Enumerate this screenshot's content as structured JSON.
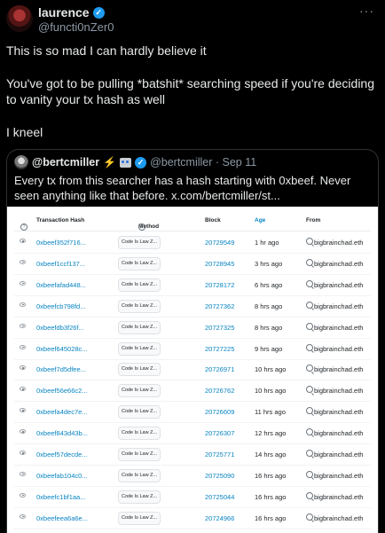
{
  "author": {
    "name": "laurence",
    "handle": "@functi0nZer0"
  },
  "post": {
    "paragraph1": "This is so mad I can hardly believe it",
    "paragraph2": "You've got to be pulling *batshit* searching speed if you're deciding to vanity your tx hash as well",
    "paragraph3": "I kneel"
  },
  "quoted": {
    "name": "@bertcmiller",
    "handle_and_date": "@bertcmiller · Sep 11",
    "text": "Every tx from this searcher has a hash starting with 0xbeef. Never seen anything like that before.  x.com/bertcmiller/st..."
  },
  "colors": {
    "background": "#000000",
    "verified": "#1d9bf0",
    "link": "#0784c3"
  },
  "table": {
    "headers": {
      "hash": "Transaction Hash",
      "method": "Method",
      "block": "Block",
      "age": "Age",
      "from": "From"
    },
    "rows": [
      {
        "hash": "0xbeef352f716...",
        "method": "Code Is Law Z...",
        "block": "20729549",
        "age": "1 hr ago",
        "from": "bigbrainchad.eth"
      },
      {
        "hash": "0xbeef1ccf137...",
        "method": "Code Is Law Z...",
        "block": "20728945",
        "age": "3 hrs ago",
        "from": "bigbrainchad.eth"
      },
      {
        "hash": "0xbeefafad448...",
        "method": "Code Is Law Z...",
        "block": "20728172",
        "age": "6 hrs ago",
        "from": "bigbrainchad.eth"
      },
      {
        "hash": "0xbeefcb798fd...",
        "method": "Code Is Law Z...",
        "block": "20727362",
        "age": "8 hrs ago",
        "from": "bigbrainchad.eth"
      },
      {
        "hash": "0xbeefdb3f26f...",
        "method": "Code Is Law Z...",
        "block": "20727325",
        "age": "8 hrs ago",
        "from": "bigbrainchad.eth"
      },
      {
        "hash": "0xbeef645028c...",
        "method": "Code Is Law Z...",
        "block": "20727225",
        "age": "9 hrs ago",
        "from": "bigbrainchad.eth"
      },
      {
        "hash": "0xbeef7d5dfee...",
        "method": "Code Is Law Z...",
        "block": "20726971",
        "age": "10 hrs ago",
        "from": "bigbrainchad.eth"
      },
      {
        "hash": "0xbeef56e66c2...",
        "method": "Code Is Law Z...",
        "block": "20726762",
        "age": "10 hrs ago",
        "from": "bigbrainchad.eth"
      },
      {
        "hash": "0xbeefa4dec7e...",
        "method": "Code Is Law Z...",
        "block": "20726609",
        "age": "11 hrs ago",
        "from": "bigbrainchad.eth"
      },
      {
        "hash": "0xbeef843d43b...",
        "method": "Code Is Law Z...",
        "block": "20726307",
        "age": "12 hrs ago",
        "from": "bigbrainchad.eth"
      },
      {
        "hash": "0xbeef57decde...",
        "method": "Code Is Law Z...",
        "block": "20725771",
        "age": "14 hrs ago",
        "from": "bigbrainchad.eth"
      },
      {
        "hash": "0xbeefab104c0...",
        "method": "Code Is Law Z...",
        "block": "20725090",
        "age": "16 hrs ago",
        "from": "bigbrainchad.eth"
      },
      {
        "hash": "0xbeefc1bf1aa...",
        "method": "Code Is Law Z...",
        "block": "20725044",
        "age": "16 hrs ago",
        "from": "bigbrainchad.eth"
      },
      {
        "hash": "0xbeefeea6a6e...",
        "method": "Code Is Law Z...",
        "block": "20724966",
        "age": "16 hrs ago",
        "from": "bigbrainchad.eth"
      }
    ]
  }
}
